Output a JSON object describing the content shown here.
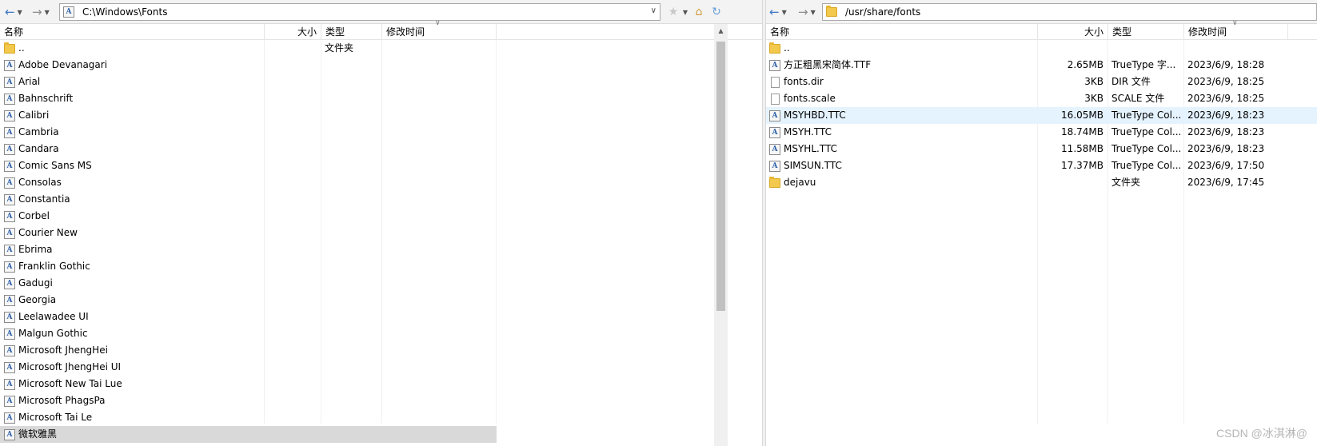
{
  "left": {
    "address": "C:\\Windows\\Fonts",
    "columns": {
      "name": "名称",
      "size": "大小",
      "type": "类型",
      "modified": "修改时间"
    },
    "rows": [
      {
        "name": "..",
        "icon": "folder-icon",
        "size": "",
        "type": "文件夹",
        "modified": ""
      },
      {
        "name": "Adobe Devanagari",
        "icon": "font-icon"
      },
      {
        "name": "Arial",
        "icon": "font-icon"
      },
      {
        "name": "Bahnschrift",
        "icon": "font-icon"
      },
      {
        "name": "Calibri",
        "icon": "font-icon"
      },
      {
        "name": "Cambria",
        "icon": "font-icon"
      },
      {
        "name": "Candara",
        "icon": "font-icon"
      },
      {
        "name": "Comic Sans MS",
        "icon": "font-icon"
      },
      {
        "name": "Consolas",
        "icon": "font-icon"
      },
      {
        "name": "Constantia",
        "icon": "font-icon"
      },
      {
        "name": "Corbel",
        "icon": "font-icon"
      },
      {
        "name": "Courier New",
        "icon": "font-icon"
      },
      {
        "name": "Ebrima",
        "icon": "font-icon"
      },
      {
        "name": "Franklin Gothic",
        "icon": "font-icon"
      },
      {
        "name": "Gadugi",
        "icon": "font-icon"
      },
      {
        "name": "Georgia",
        "icon": "font-icon"
      },
      {
        "name": "Leelawadee UI",
        "icon": "font-icon"
      },
      {
        "name": "Malgun Gothic",
        "icon": "font-icon"
      },
      {
        "name": "Microsoft JhengHei",
        "icon": "font-icon"
      },
      {
        "name": "Microsoft JhengHei UI",
        "icon": "font-icon"
      },
      {
        "name": "Microsoft New Tai Lue",
        "icon": "font-icon"
      },
      {
        "name": "Microsoft PhagsPa",
        "icon": "font-icon"
      },
      {
        "name": "Microsoft Tai Le",
        "icon": "font-icon"
      },
      {
        "name": "微软雅黑",
        "icon": "font-icon",
        "state": "hover"
      }
    ]
  },
  "right": {
    "address": "/usr/share/fonts",
    "columns": {
      "name": "名称",
      "size": "大小",
      "type": "类型",
      "modified": "修改时间"
    },
    "rows": [
      {
        "name": "..",
        "icon": "folder-icon",
        "size": "",
        "type": "",
        "modified": ""
      },
      {
        "name": "方正粗黑宋简体.TTF",
        "icon": "font-icon",
        "size": "2.65MB",
        "type": "TrueType 字...",
        "modified": "2023/6/9, 18:28"
      },
      {
        "name": "fonts.dir",
        "icon": "file-icon",
        "size": "3KB",
        "type": "DIR 文件",
        "modified": "2023/6/9, 18:25"
      },
      {
        "name": "fonts.scale",
        "icon": "file-icon",
        "size": "3KB",
        "type": "SCALE 文件",
        "modified": "2023/6/9, 18:25"
      },
      {
        "name": "MSYHBD.TTC",
        "icon": "font-icon",
        "size": "16.05MB",
        "type": "TrueType Col...",
        "modified": "2023/6/9, 18:23",
        "state": "selected"
      },
      {
        "name": "MSYH.TTC",
        "icon": "font-icon",
        "size": "18.74MB",
        "type": "TrueType Col...",
        "modified": "2023/6/9, 18:23"
      },
      {
        "name": "MSYHL.TTC",
        "icon": "font-icon",
        "size": "11.58MB",
        "type": "TrueType Col...",
        "modified": "2023/6/9, 18:23"
      },
      {
        "name": "SIMSUN.TTC",
        "icon": "font-icon",
        "size": "17.37MB",
        "type": "TrueType Col...",
        "modified": "2023/6/9, 17:50"
      },
      {
        "name": "dejavu",
        "icon": "folder-icon",
        "size": "",
        "type": "文件夹",
        "modified": "2023/6/9, 17:45"
      }
    ]
  },
  "watermark": "CSDN @冰淇淋@",
  "colors": {
    "accent": "#3b78c4",
    "selected_row": "#e5f3ff",
    "hover_row": "#d9d9d9",
    "folder": "#f2c94c"
  }
}
